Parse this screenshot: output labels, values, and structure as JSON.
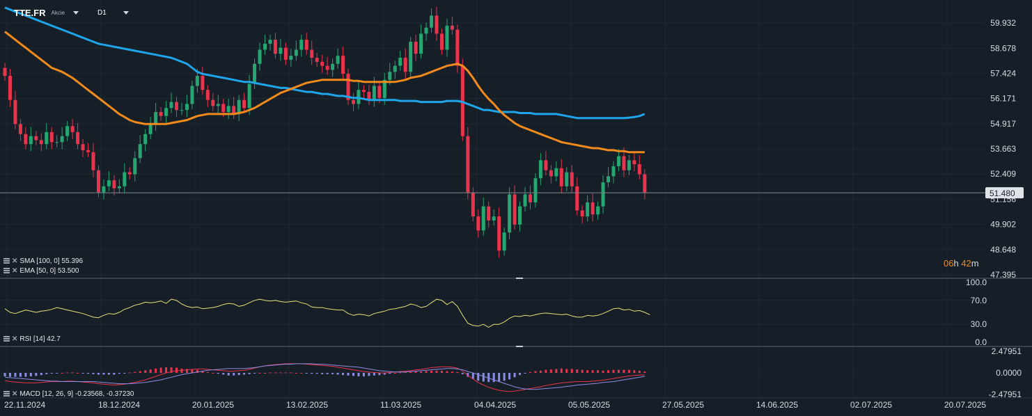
{
  "header": {
    "symbol": "TTE.FR",
    "instrument_type": "Akcie",
    "timeframe": "D1"
  },
  "price_axis": {
    "ticks": [
      "59.932",
      "58.678",
      "57.424",
      "56.171",
      "54.917",
      "53.663",
      "52.409",
      "51.156",
      "49.902",
      "48.648",
      "47.395"
    ],
    "current_price": "51.480"
  },
  "rsi_axis": {
    "ticks": [
      "100.0",
      "70.0",
      "30.0",
      "0.0"
    ]
  },
  "macd_axis": {
    "ticks": [
      "2.47951",
      "0.0000",
      "-2.47951"
    ]
  },
  "time_axis": {
    "ticks": [
      "22.11.2024",
      "18.12.2024",
      "20.01.2025",
      "13.02.2025",
      "11.03.2025",
      "04.04.2025",
      "05.05.2025",
      "27.05.2025",
      "14.06.2025",
      "02.07.2025",
      "20.07.2025"
    ]
  },
  "indicators": {
    "sma": "SMA [100, 0] 55.396",
    "ema": "EMA [50, 0] 53.500",
    "rsi": "RSI [14] 42.7",
    "macd": "MACD [12, 26, 9] -0.23568, -0.37230"
  },
  "countdown": {
    "hours": "06",
    "h": "h",
    "minutes": "42",
    "m": "m"
  },
  "colors": {
    "background": "#161f27",
    "up": "#26a671",
    "down": "#e8344d",
    "sma": "#1ea5ea",
    "ema": "#f28a1c",
    "rsi": "#e6e27a",
    "macd_line": "#e8344d",
    "signal_line": "#8c8ce6",
    "hist_pos": "#e8344d",
    "hist_neg": "#8c8ce6"
  },
  "chart_data": {
    "type": "candlestick",
    "price_range": [
      47.395,
      60.8
    ],
    "rsi_range": [
      0,
      100
    ],
    "macd_range": [
      -2.47951,
      2.47951
    ],
    "closes": [
      57.3,
      56.1,
      54.9,
      54.4,
      53.9,
      54.3,
      54.1,
      53.9,
      54.5,
      54.0,
      54.0,
      54.3,
      54.8,
      54.5,
      53.9,
      53.6,
      53.5,
      52.6,
      51.5,
      51.8,
      52.1,
      51.7,
      51.8,
      52.5,
      52.4,
      53.2,
      53.9,
      54.4,
      54.9,
      55.5,
      55.3,
      55.7,
      56.0,
      55.6,
      55.6,
      55.9,
      56.8,
      57.3,
      56.6,
      56.1,
      55.8,
      55.9,
      55.5,
      55.8,
      55.4,
      56.1,
      55.7,
      56.9,
      57.9,
      58.6,
      58.9,
      59.1,
      58.4,
      58.7,
      58.1,
      58.3,
      58.6,
      59.1,
      58.6,
      58.2,
      58.0,
      57.8,
      57.6,
      57.9,
      58.3,
      57.4,
      56.1,
      55.9,
      56.6,
      56.5,
      56.1,
      56.8,
      56.2,
      57.1,
      57.5,
      57.8,
      58.2,
      57.5,
      59.0,
      58.4,
      59.4,
      59.7,
      60.3,
      59.4,
      58.6,
      59.8,
      59.6,
      57.8,
      54.3,
      51.5,
      50.3,
      49.6,
      50.8,
      50.1,
      50.3,
      48.6,
      49.5,
      51.4,
      49.9,
      50.8,
      51.4,
      51.0,
      52.2,
      53.1,
      52.6,
      52.3,
      52.7,
      51.8,
      52.5,
      51.8,
      50.6,
      50.3,
      51.0,
      50.4,
      50.8,
      52.0,
      52.3,
      52.8,
      53.3,
      52.6,
      53.1,
      52.9,
      52.4,
      51.5
    ],
    "sma_100": [
      60.7,
      60.6,
      60.5,
      60.4,
      60.3,
      60.2,
      60.1,
      60.0,
      59.9,
      59.8,
      59.7,
      59.6,
      59.5,
      59.4,
      59.3,
      59.2,
      59.1,
      59.0,
      58.9,
      58.85,
      58.8,
      58.75,
      58.7,
      58.65,
      58.6,
      58.55,
      58.5,
      58.45,
      58.4,
      58.35,
      58.3,
      58.25,
      58.2,
      58.1,
      58.0,
      57.9,
      57.7,
      57.5,
      57.4,
      57.35,
      57.3,
      57.25,
      57.2,
      57.15,
      57.1,
      57.05,
      57.0,
      57.0,
      56.95,
      56.9,
      56.85,
      56.8,
      56.75,
      56.7,
      56.7,
      56.65,
      56.6,
      56.55,
      56.5,
      56.5,
      56.45,
      56.4,
      56.4,
      56.35,
      56.3,
      56.3,
      56.25,
      56.2,
      56.2,
      56.15,
      56.1,
      56.1,
      56.1,
      56.1,
      56.1,
      56.1,
      56.05,
      56.05,
      56.05,
      56.05,
      56.0,
      56.0,
      56.0,
      56.0,
      56.0,
      56.05,
      56.05,
      56.05,
      56.0,
      55.9,
      55.8,
      55.7,
      55.6,
      55.6,
      55.55,
      55.5,
      55.5,
      55.5,
      55.5,
      55.45,
      55.45,
      55.45,
      55.4,
      55.4,
      55.4,
      55.4,
      55.4,
      55.35,
      55.3,
      55.25,
      55.2,
      55.2,
      55.2,
      55.2,
      55.2,
      55.2,
      55.2,
      55.2,
      55.2,
      55.2,
      55.22,
      55.25,
      55.3,
      55.4
    ],
    "ema_50": [
      59.5,
      59.3,
      59.1,
      58.9,
      58.7,
      58.5,
      58.3,
      58.1,
      57.9,
      57.7,
      57.6,
      57.5,
      57.35,
      57.2,
      57.0,
      56.8,
      56.6,
      56.4,
      56.2,
      56.0,
      55.8,
      55.6,
      55.4,
      55.25,
      55.1,
      55.0,
      54.95,
      54.9,
      54.9,
      54.9,
      54.9,
      54.9,
      54.95,
      55.0,
      55.05,
      55.1,
      55.2,
      55.3,
      55.35,
      55.4,
      55.4,
      55.4,
      55.4,
      55.4,
      55.4,
      55.45,
      55.5,
      55.6,
      55.7,
      55.85,
      56.0,
      56.15,
      56.3,
      56.45,
      56.55,
      56.65,
      56.75,
      56.85,
      56.95,
      57.0,
      57.05,
      57.1,
      57.1,
      57.1,
      57.1,
      57.1,
      57.1,
      57.05,
      57.05,
      57.0,
      57.0,
      57.0,
      57.0,
      57.0,
      57.0,
      57.0,
      57.05,
      57.1,
      57.2,
      57.25,
      57.3,
      57.4,
      57.5,
      57.6,
      57.7,
      57.8,
      57.85,
      57.9,
      57.8,
      57.55,
      57.2,
      56.8,
      56.45,
      56.15,
      55.9,
      55.6,
      55.35,
      55.15,
      54.95,
      54.8,
      54.7,
      54.6,
      54.5,
      54.4,
      54.3,
      54.2,
      54.1,
      54.0,
      53.95,
      53.9,
      53.85,
      53.8,
      53.75,
      53.7,
      53.7,
      53.65,
      53.6,
      53.6,
      53.55,
      53.55,
      53.5,
      53.5,
      53.5,
      53.5
    ],
    "rsi_14": [
      56,
      50,
      48,
      51,
      54,
      52,
      50,
      52,
      53,
      55,
      58,
      56,
      54,
      52,
      50,
      48,
      45,
      42,
      41,
      45,
      48,
      47,
      50,
      55,
      58,
      62,
      64,
      67,
      66,
      67,
      69,
      65,
      72,
      70,
      64,
      60,
      58,
      59,
      56,
      57,
      58,
      60,
      63,
      65,
      64,
      60,
      62,
      66,
      70,
      72,
      70,
      69,
      70,
      68,
      67,
      68,
      69,
      66,
      64,
      59,
      58,
      58,
      56,
      55,
      54,
      54,
      48,
      45,
      47,
      46,
      44,
      48,
      50,
      52,
      55,
      56,
      58,
      60,
      64,
      62,
      58,
      60,
      66,
      72,
      70,
      63,
      68,
      60,
      45,
      32,
      28,
      27,
      30,
      25,
      30,
      30,
      34,
      40,
      44,
      43,
      45,
      44,
      46,
      48,
      49,
      48,
      47,
      46,
      47,
      44,
      42,
      42,
      45,
      44,
      45,
      48,
      52,
      56,
      57,
      54,
      55,
      52,
      53,
      50,
      46
    ],
    "macd_line": [
      -0.9,
      -1.0,
      -1.05,
      -1.1,
      -1.15,
      -1.15,
      -1.15,
      -1.1,
      -1.05,
      -1.0,
      -1.0,
      -1.0,
      -0.95,
      -0.95,
      -1.0,
      -1.05,
      -1.1,
      -1.15,
      -1.25,
      -1.3,
      -1.35,
      -1.4,
      -1.35,
      -1.3,
      -1.2,
      -1.1,
      -0.95,
      -0.8,
      -0.6,
      -0.4,
      -0.2,
      0.0,
      0.15,
      0.25,
      0.3,
      0.35,
      0.4,
      0.45,
      0.45,
      0.4,
      0.35,
      0.3,
      0.25,
      0.2,
      0.2,
      0.25,
      0.3,
      0.4,
      0.55,
      0.7,
      0.8,
      0.9,
      0.95,
      1.0,
      1.05,
      1.05,
      1.05,
      1.05,
      1.0,
      0.95,
      0.9,
      0.85,
      0.8,
      0.75,
      0.65,
      0.55,
      0.45,
      0.35,
      0.25,
      0.15,
      0.1,
      0.05,
      0.0,
      0.0,
      0.05,
      0.1,
      0.15,
      0.2,
      0.25,
      0.35,
      0.4,
      0.5,
      0.6,
      0.65,
      0.7,
      0.7,
      0.65,
      0.55,
      0.2,
      -0.3,
      -0.7,
      -1.1,
      -1.4,
      -1.65,
      -1.85,
      -2.0,
      -2.1,
      -2.15,
      -2.1,
      -2.0,
      -1.9,
      -1.8,
      -1.7,
      -1.6,
      -1.45,
      -1.35,
      -1.25,
      -1.15,
      -1.1,
      -1.05,
      -1.0,
      -1.0,
      -1.0,
      -0.95,
      -0.9,
      -0.85,
      -0.75,
      -0.65,
      -0.55,
      -0.45,
      -0.35,
      -0.3,
      -0.25,
      -0.24
    ],
    "signal_line": [
      -0.5,
      -0.55,
      -0.6,
      -0.65,
      -0.7,
      -0.75,
      -0.8,
      -0.85,
      -0.9,
      -0.95,
      -0.95,
      -1.0,
      -1.0,
      -1.0,
      -1.0,
      -1.0,
      -1.0,
      -1.0,
      -1.05,
      -1.1,
      -1.15,
      -1.2,
      -1.25,
      -1.25,
      -1.25,
      -1.2,
      -1.15,
      -1.1,
      -1.0,
      -0.9,
      -0.8,
      -0.65,
      -0.5,
      -0.35,
      -0.2,
      -0.1,
      0.0,
      0.1,
      0.2,
      0.3,
      0.35,
      0.4,
      0.45,
      0.5,
      0.5,
      0.5,
      0.5,
      0.55,
      0.6,
      0.7,
      0.8,
      0.85,
      0.9,
      0.95,
      1.0,
      1.0,
      1.05,
      1.05,
      1.05,
      1.05,
      1.0,
      1.0,
      0.95,
      0.9,
      0.85,
      0.8,
      0.75,
      0.7,
      0.65,
      0.55,
      0.45,
      0.35,
      0.25,
      0.2,
      0.15,
      0.1,
      0.1,
      0.1,
      0.15,
      0.2,
      0.25,
      0.3,
      0.35,
      0.4,
      0.45,
      0.5,
      0.5,
      0.45,
      0.35,
      0.15,
      0.0,
      -0.2,
      -0.4,
      -0.6,
      -0.8,
      -1.0,
      -1.2,
      -1.4,
      -1.6,
      -1.75,
      -1.85,
      -1.9,
      -1.9,
      -1.85,
      -1.8,
      -1.75,
      -1.7,
      -1.65,
      -1.55,
      -1.5,
      -1.4,
      -1.35,
      -1.3,
      -1.25,
      -1.2,
      -1.1,
      -1.05,
      -1.0,
      -0.9,
      -0.8,
      -0.7,
      -0.6,
      -0.5,
      -0.4
    ]
  }
}
